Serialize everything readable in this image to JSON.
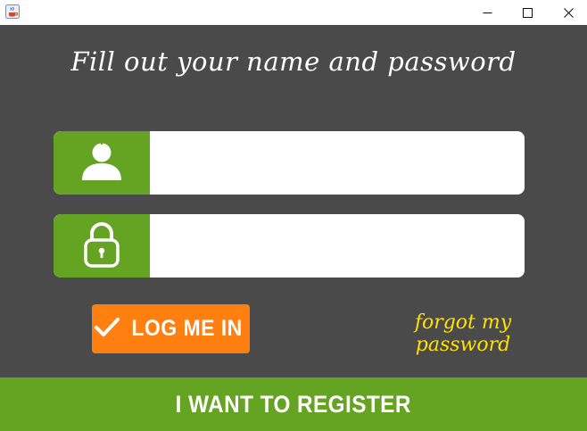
{
  "window": {
    "app_icon": "java-cup-icon",
    "controls": {
      "minimize": "minimize-icon",
      "maximize": "maximize-icon",
      "close": "close-icon"
    }
  },
  "form": {
    "heading": "Fill out your name and password",
    "username": {
      "icon": "user-icon",
      "value": "",
      "placeholder": ""
    },
    "password": {
      "icon": "padlock-icon",
      "value": "",
      "placeholder": ""
    }
  },
  "actions": {
    "login_label": "LOG ME IN",
    "login_icon": "checkmark-icon",
    "forgot_label": "forgot my password",
    "register_label": "I WANT TO REGISTER"
  },
  "colors": {
    "background": "#4a4a4a",
    "accent_green": "#65a323",
    "accent_orange": "#ff7f11",
    "link_yellow": "#ffe100",
    "field_white": "#ffffff"
  }
}
